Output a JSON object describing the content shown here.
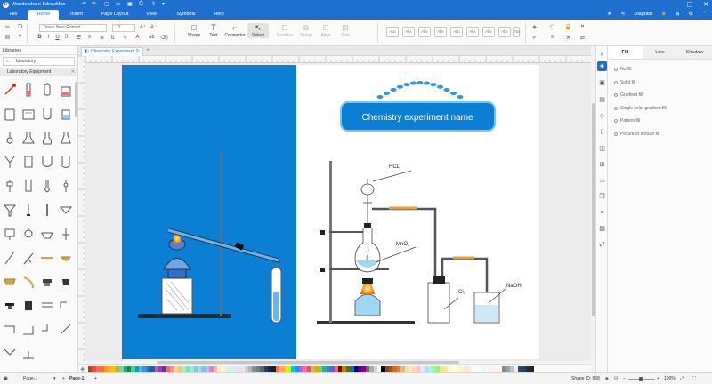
{
  "app": {
    "title": "Wondershare EdrawMax",
    "logo": "D"
  },
  "menu": {
    "items": [
      "File",
      "Home",
      "Insert",
      "Page Layout",
      "View",
      "Symbols",
      "Help"
    ],
    "active": "Home",
    "account_label": "Diagram"
  },
  "ribbon": {
    "font_name": "Times New Roman",
    "font_size": "12",
    "tools": [
      "Shape",
      "Text",
      "Connector",
      "Select"
    ],
    "disabled_tools": [
      "Position",
      "Group",
      "Align",
      "Size"
    ],
    "style_labels": [
      "Abc",
      "Abc",
      "Abc",
      "Abc",
      "Abc",
      "Abc",
      "Abc",
      "Abc",
      "Abc"
    ]
  },
  "libraries": {
    "title": "Libraries",
    "search_value": "laboratory",
    "category": "Laboratory Equipment"
  },
  "document": {
    "tab_label": "Chemistry Experiment 2"
  },
  "canvas": {
    "diagram_title": "Chemistry experiment name",
    "labels": {
      "hcl": "HCL",
      "mno2": "MnO₂",
      "cl2": "Cl₂",
      "naoh": "NaOH"
    },
    "colors": {
      "blue_panel": "#0a7fd4",
      "title_fill": "#0a7fd4",
      "flame": "#f5a623",
      "glass": "#9fd8f5"
    }
  },
  "right_panel": {
    "tabs": [
      "Fill",
      "Line",
      "Shadow"
    ],
    "active_tab": "Fill",
    "fill_options": [
      "No fill",
      "Solid fill",
      "Gradient fill",
      "Single color gradient fill",
      "Pattern fill",
      "Picture or texture fill"
    ]
  },
  "status": {
    "page_selector": "Page-1",
    "page_tab": "Page-1",
    "shape_id": "Shape ID: 658",
    "zoom": "100%"
  },
  "palette": {
    "colors": [
      "#c0392b",
      "#e74c3c",
      "#f06a6a",
      "#e67e22",
      "#f39c12",
      "#f5b041",
      "#f1c40f",
      "#d4ac0d",
      "#7dcea0",
      "#27ae60",
      "#1e8449",
      "#48c9b0",
      "#16a085",
      "#5dade2",
      "#3498db",
      "#2874a6",
      "#1f618d",
      "#a569bd",
      "#8e44ad",
      "#6c3483",
      "#ec7063",
      "#f1948a",
      "#fad7a0",
      "#f8c471",
      "#abebc6",
      "#82e0aa",
      "#a3e4d7",
      "#76d7c4",
      "#aed6f1",
      "#85c1e9",
      "#d2b4de",
      "#bb8fce",
      "#f5b7b1",
      "#fdebd0",
      "#fcf3cf",
      "#d5f5e3",
      "#d1f2eb",
      "#d6eaf8",
      "#ebdef0",
      "#e5e7e9",
      "#ccd1d1",
      "#aab7b8",
      "#839192",
      "#717d7e",
      "#566573",
      "#2c3e50",
      "#1c2833",
      "#17202a",
      "#ff6f61",
      "#ffa07a",
      "#ffd700",
      "#adff2f",
      "#00ced1",
      "#1e90ff",
      "#9370db",
      "#ff69b4",
      "#cd5c5c",
      "#f4a460",
      "#daa520",
      "#9acd32",
      "#20b2aa",
      "#4682b4",
      "#6a5acd",
      "#db7093",
      "#8b0000",
      "#b8860b",
      "#556b2f",
      "#008080",
      "#000080",
      "#4b0082",
      "#800080",
      "#696969",
      "#a9a9a9",
      "#d3d3d3",
      "#f5f5f5",
      "#000000",
      "#8b4513",
      "#a0522d",
      "#d2691e",
      "#cd853f",
      "#deb887",
      "#f5deb3",
      "#ffe4c4",
      "#ffdab9",
      "#ffc0cb",
      "#e6e6fa",
      "#b0e0e6",
      "#afeeee",
      "#98fb98",
      "#90ee90",
      "#f0e68c",
      "#eee8aa",
      "#fafad2",
      "#ffffe0",
      "#fffacd",
      "#ffefd5",
      "#ffe4e1",
      "#faebd7",
      "#f0fff0",
      "#f5fffa",
      "#f0ffff",
      "#f0f8ff",
      "#f8f8ff",
      "#fff0f5",
      "#fdf5e6",
      "#fffaf0",
      "#7f8c8d",
      "#95a5a6",
      "#bdc3c7",
      "#ecf0f1",
      "#34495e",
      "#2e4053",
      "#212f3c",
      "#1b2631"
    ]
  }
}
